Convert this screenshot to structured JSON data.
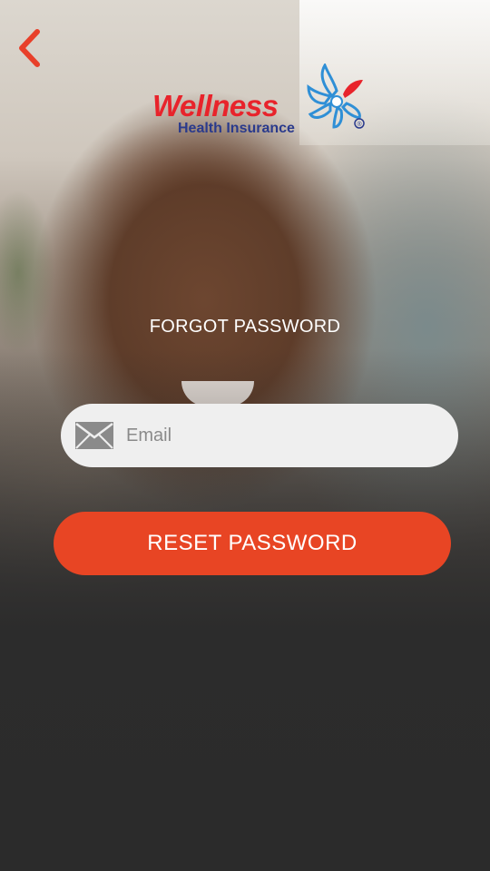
{
  "colors": {
    "accent": "#e84524",
    "back_chevron": "#e8402a",
    "logo_red": "#e8232b",
    "logo_blue": "#2a3a8c",
    "field_bg": "#efefef"
  },
  "nav": {
    "back_icon": "chevron-left-icon"
  },
  "logo": {
    "wordmark": "Wellness",
    "subtitle": "Health Insurance",
    "registered": "®",
    "mark_icon": "flower-icon"
  },
  "form": {
    "heading": "FORGOT PASSWORD",
    "email": {
      "icon": "envelope-icon",
      "placeholder": "Email",
      "value": ""
    },
    "submit_label": "RESET PASSWORD"
  }
}
